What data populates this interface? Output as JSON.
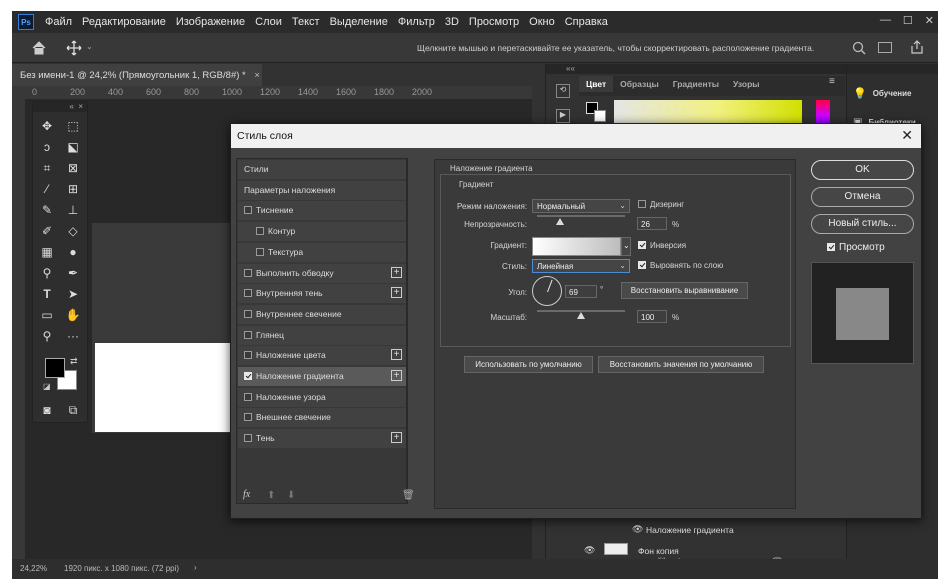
{
  "app": {
    "logo": "Ps",
    "menu": [
      "Файл",
      "Редактирование",
      "Изображение",
      "Слои",
      "Текст",
      "Выделение",
      "Фильтр",
      "3D",
      "Просмотр",
      "Окно",
      "Справка"
    ]
  },
  "window_controls": {
    "minimize": "—",
    "maximize": "☐",
    "close": "✕"
  },
  "options": {
    "hint": "Щелкните мышью и перетаскивайте ее указатель, чтобы скорректировать расположение градиента."
  },
  "document": {
    "tab": "Без имени-1 @ 24,2% (Прямоугольник 1, RGB/8#) *",
    "tab_close": "×"
  },
  "ruler_marks": [
    "0",
    "200",
    "400",
    "600",
    "800",
    "1000",
    "1200",
    "1400",
    "1600",
    "1800",
    "2000"
  ],
  "right_panel": {
    "tabs": [
      "Цвет",
      "Образцы",
      "Градиенты",
      "Узоры"
    ],
    "side_items": [
      "Обучение",
      "Библиотеки"
    ],
    "layers": [
      {
        "name": "Наложение градиента"
      },
      {
        "name": "Фон копия"
      }
    ]
  },
  "dialog": {
    "title": "Стиль слоя",
    "styles": [
      {
        "label": "Стили",
        "checkbox": false,
        "checked": false,
        "plus": false,
        "indent": false
      },
      {
        "label": "Параметры наложения",
        "checkbox": false,
        "checked": false,
        "plus": false,
        "indent": false
      },
      {
        "label": "Тиснение",
        "checkbox": true,
        "checked": false,
        "plus": false,
        "indent": false
      },
      {
        "label": "Контур",
        "checkbox": true,
        "checked": false,
        "plus": false,
        "indent": true
      },
      {
        "label": "Текстура",
        "checkbox": true,
        "checked": false,
        "plus": false,
        "indent": true
      },
      {
        "label": "Выполнить обводку",
        "checkbox": true,
        "checked": false,
        "plus": true,
        "indent": false
      },
      {
        "label": "Внутренняя тень",
        "checkbox": true,
        "checked": false,
        "plus": true,
        "indent": false
      },
      {
        "label": "Внутреннее свечение",
        "checkbox": true,
        "checked": false,
        "plus": false,
        "indent": false
      },
      {
        "label": "Глянец",
        "checkbox": true,
        "checked": false,
        "plus": false,
        "indent": false
      },
      {
        "label": "Наложение цвета",
        "checkbox": true,
        "checked": false,
        "plus": true,
        "indent": false
      },
      {
        "label": "Наложение градиента",
        "checkbox": true,
        "checked": true,
        "plus": true,
        "indent": false,
        "selected": true
      },
      {
        "label": "Наложение узора",
        "checkbox": true,
        "checked": false,
        "plus": false,
        "indent": false
      },
      {
        "label": "Внешнее свечение",
        "checkbox": true,
        "checked": false,
        "plus": false,
        "indent": false
      },
      {
        "label": "Тень",
        "checkbox": true,
        "checked": false,
        "plus": true,
        "indent": false
      }
    ],
    "fx": "fx",
    "section_title": "Наложение градиента",
    "group_title": "Градиент",
    "blend_mode_label": "Режим наложения:",
    "blend_mode_value": "Нормальный",
    "dither_label": "Дизеринг",
    "dither_checked": false,
    "opacity_label": "Непрозрачность:",
    "opacity_value": "26",
    "opacity_fraction": 0.26,
    "percent": "%",
    "gradient_label": "Градиент:",
    "reverse_label": "Инверсия",
    "reverse_checked": true,
    "style_label": "Стиль:",
    "style_value": "Линейная",
    "align_label": "Выровнять по слою",
    "align_checked": true,
    "angle_label": "Угол:",
    "angle_value": "69",
    "degree": "°",
    "reset_alignment": "Восстановить выравнивание",
    "scale_label": "Масштаб:",
    "scale_value": "100",
    "scale_fraction": 0.5,
    "make_default": "Использовать по умолчанию",
    "reset_default": "Восстановить значения по умолчанию",
    "ok": "OK",
    "cancel": "Отмена",
    "new_style": "Новый стиль...",
    "preview_label": "Просмотр",
    "preview_checked": true
  },
  "status": {
    "zoom": "24,22%",
    "doc_info": "1920 пикс. x 1080 пикс. (72 ppi)"
  },
  "colors": {
    "accent": "#0b1b33",
    "panel": "#323232",
    "dialog": "#424242"
  }
}
